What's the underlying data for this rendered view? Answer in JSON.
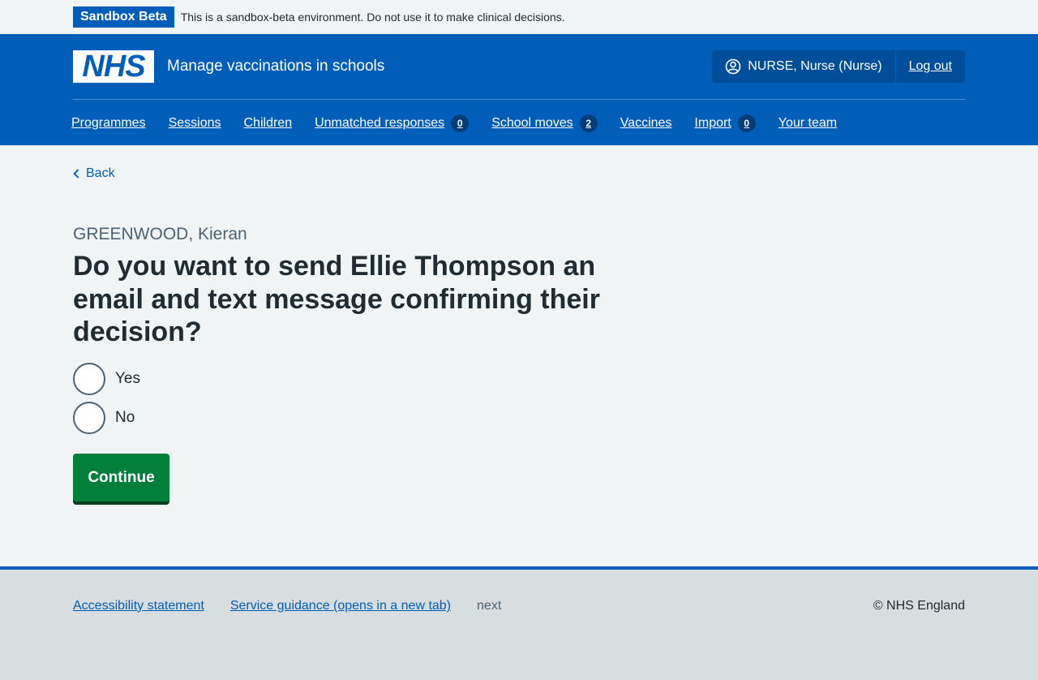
{
  "banner": {
    "tag": "Sandbox Beta",
    "text": "This is a sandbox-beta environment. Do not use it to make clinical decisions."
  },
  "header": {
    "logo_text": "NHS",
    "service_name": "Manage vaccinations in schools",
    "user_label": "NURSE, Nurse (Nurse)",
    "logout_label": "Log out"
  },
  "nav": {
    "programmes": "Programmes",
    "sessions": "Sessions",
    "children": "Children",
    "unmatched": "Unmatched responses",
    "unmatched_count": "0",
    "school_moves": "School moves",
    "school_moves_count": "2",
    "vaccines": "Vaccines",
    "import": "Import",
    "import_count": "0",
    "your_team": "Your team"
  },
  "main": {
    "back_label": "Back",
    "caption": "GREENWOOD, Kieran",
    "heading": "Do you want to send Ellie Thompson an email and text message confirming their decision?",
    "options": [
      "Yes",
      "No"
    ],
    "continue_label": "Continue"
  },
  "footer": {
    "accessibility": "Accessibility statement",
    "guidance": "Service guidance (opens in a new tab)",
    "version": "next",
    "copyright": "© NHS England"
  },
  "colors": {
    "nhs_blue": "#005eb8",
    "button_green": "#007f3b",
    "background": "#f0f4f5",
    "footer_bg": "#d8dde0"
  }
}
